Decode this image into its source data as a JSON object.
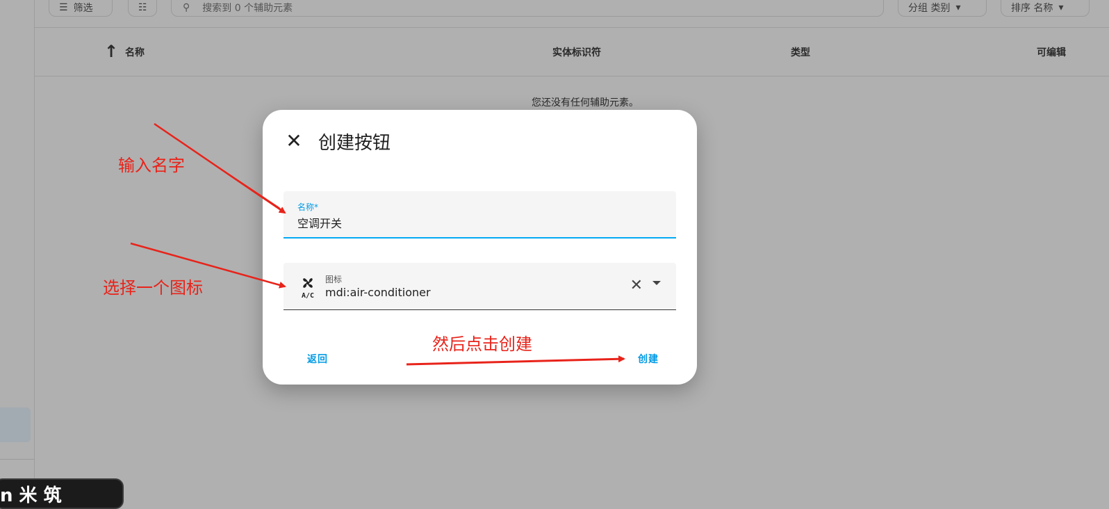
{
  "toolbar": {
    "filter_label": "筛选",
    "search_placeholder": "搜索到 0 个辅助元素",
    "group_label": "分组 类别",
    "sort_label": "排序 名称"
  },
  "table": {
    "columns": [
      "名称",
      "实体标识符",
      "类型",
      "可编辑"
    ],
    "empty_message": "您还没有任何辅助元素。"
  },
  "sidebar": {
    "bottom_chip_text": "n   米  筑"
  },
  "dialog": {
    "title": "创建按钮",
    "name_field": {
      "label": "名称*",
      "value": "空调开关"
    },
    "icon_field": {
      "label": "图标",
      "value": "mdi:air-conditioner",
      "icon_name": "air-conditioner-icon"
    },
    "back_button": "返回",
    "create_button": "创建"
  },
  "annotations": {
    "enter_name": "输入名字",
    "choose_icon": "选择一个图标",
    "then_click_create": "然后点击创建",
    "color": "#e8231a"
  },
  "colors": {
    "accent": "#03a9f4",
    "overlay": "#b0b0b0"
  }
}
